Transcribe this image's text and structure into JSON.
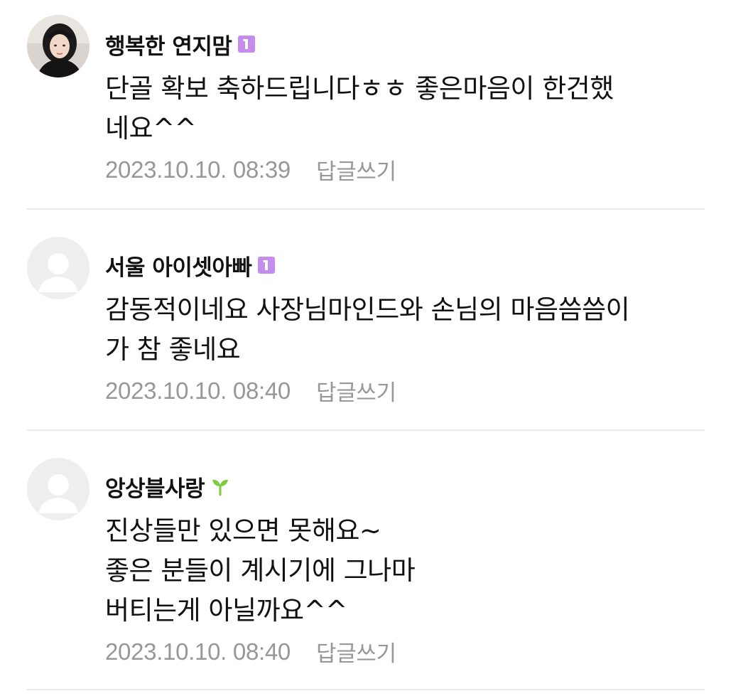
{
  "colors": {
    "badge": "#c58cf0",
    "sprout": "#7ccc3f",
    "meta_text": "#979797",
    "divider": "#ebebeb"
  },
  "comments": [
    {
      "nickname": "행복한 연지맘",
      "badge": "level-1",
      "badge_icon": "level-badge-icon",
      "avatar": "profile-photo",
      "content": "단골 확보 축하드립니다ㅎㅎ 좋은마음이 한건했\n네요^^",
      "date": "2023.10.10. 08:39",
      "reply_label": "답글쓰기"
    },
    {
      "nickname": "서울 아이셋아빠",
      "badge": "level-1",
      "badge_icon": "level-badge-icon",
      "avatar": "default-avatar",
      "content": "감동적이네요 사장님마인드와 손님의 마음씀씀이\n가 참 좋네요",
      "date": "2023.10.10. 08:40",
      "reply_label": "답글쓰기"
    },
    {
      "nickname": "앙상블사랑",
      "badge": "sprout",
      "badge_icon": "sprout-icon",
      "avatar": "default-avatar",
      "content": "진상들만 있으면 못해요~\n좋은 분들이 계시기에 그나마\n버티는게 아닐까요^^",
      "date": "2023.10.10. 08:40",
      "reply_label": "답글쓰기"
    }
  ]
}
